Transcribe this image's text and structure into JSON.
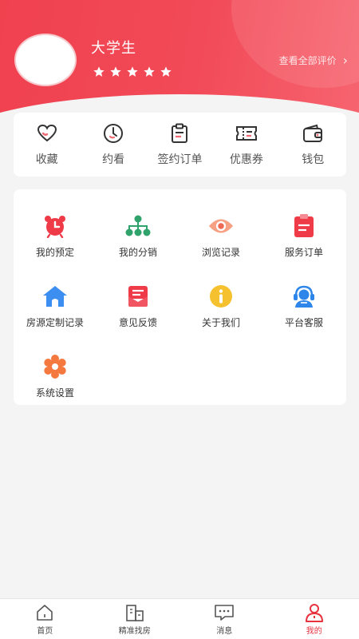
{
  "profile": {
    "name": "大学生",
    "rating": 5,
    "review_link": "查看全部评价",
    "review_arrow": "›"
  },
  "quick_actions": [
    {
      "label": "收藏",
      "icon": "heart-icon"
    },
    {
      "label": "约看",
      "icon": "clock-icon"
    },
    {
      "label": "签约订单",
      "icon": "document-icon"
    },
    {
      "label": "优惠券",
      "icon": "ticket-icon"
    },
    {
      "label": "钱包",
      "icon": "wallet-icon"
    }
  ],
  "services": [
    {
      "label": "我的预定",
      "icon": "alarm-clock-icon"
    },
    {
      "label": "我的分销",
      "icon": "org-chart-icon"
    },
    {
      "label": "浏览记录",
      "icon": "eye-icon"
    },
    {
      "label": "服务订单",
      "icon": "clipboard-icon"
    },
    {
      "label": "房源定制记录",
      "icon": "house-icon"
    },
    {
      "label": "意见反馈",
      "icon": "feedback-icon"
    },
    {
      "label": "关于我们",
      "icon": "info-icon"
    },
    {
      "label": "平台客服",
      "icon": "customer-service-icon"
    },
    {
      "label": "系统设置",
      "icon": "gear-icon"
    }
  ],
  "bottom_nav": [
    {
      "label": "首页",
      "icon": "home-icon"
    },
    {
      "label": "精准找房",
      "icon": "building-icon"
    },
    {
      "label": "消息",
      "icon": "message-icon"
    },
    {
      "label": "我的",
      "icon": "user-icon",
      "active": true
    }
  ],
  "colors": {
    "accent": "#e8323f",
    "header_start": "#f0414f",
    "header_end": "#f6646f"
  }
}
